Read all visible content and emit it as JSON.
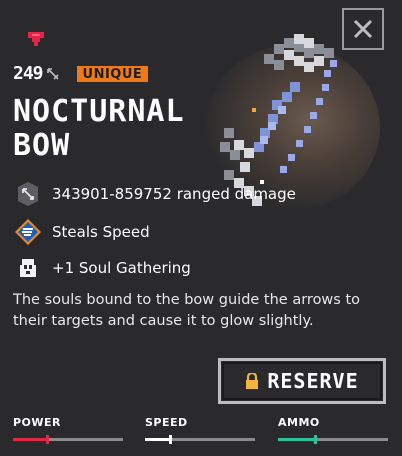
{
  "item": {
    "power": "249",
    "rarity_label": "UNIQUE",
    "name": "NOCTURNAL BOW",
    "description": "The souls bound to the bow guide the arrows to their targets and cause it to glow slightly."
  },
  "stats": [
    {
      "icon": "ranged-damage-icon",
      "text": "343901-859752 ranged damage"
    },
    {
      "icon": "speed-enchant-icon",
      "text": "Steals Speed"
    },
    {
      "icon": "soul-icon",
      "text": "+1 Soul Gathering"
    }
  ],
  "actions": {
    "reserve_label": "RESERVE",
    "reserve_icon": "lock-icon",
    "close_icon": "close-icon"
  },
  "meters": [
    {
      "label": "POWER",
      "level": 0.3,
      "color": "#e0284a"
    },
    {
      "label": "SPEED",
      "level": 0.22,
      "color": "#ffffff"
    },
    {
      "label": "AMMO",
      "level": 0.33,
      "color": "#2ec39a"
    }
  ],
  "colors": {
    "rarity": "#f07a17",
    "rarity_icon": "#e8234a",
    "background": "#2a2a2c"
  }
}
